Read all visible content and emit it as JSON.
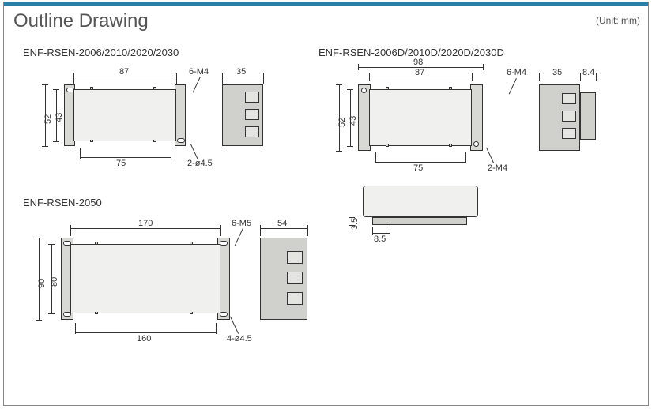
{
  "title": "Outline Drawing",
  "unit_label": "(Unit: mm)",
  "parts": {
    "a": {
      "subtitle": "ENF-RSEN-2006/2010/2020/2030",
      "dims": {
        "w": "87",
        "d": "35",
        "h1": "52",
        "h2": "43",
        "mount": "75"
      },
      "callouts": {
        "screws": "6-M4",
        "holes": "2-ø4.5"
      }
    },
    "b": {
      "subtitle": "ENF-RSEN-2006D/2010D/2020D/2030D",
      "dims": {
        "total_w": "98",
        "w": "87",
        "d": "35",
        "din": "8.4",
        "h1": "52",
        "h2": "43",
        "mount": "75",
        "side_off": "8.5",
        "side_h": "3.5"
      },
      "callouts": {
        "screws": "6-M4",
        "mholes": "2-M4"
      }
    },
    "c": {
      "subtitle": "ENF-RSEN-2050",
      "dims": {
        "w": "170",
        "d": "54",
        "h1": "90",
        "h2": "80",
        "mount": "160"
      },
      "callouts": {
        "screws": "6-M5",
        "holes": "4-ø4.5"
      }
    }
  }
}
